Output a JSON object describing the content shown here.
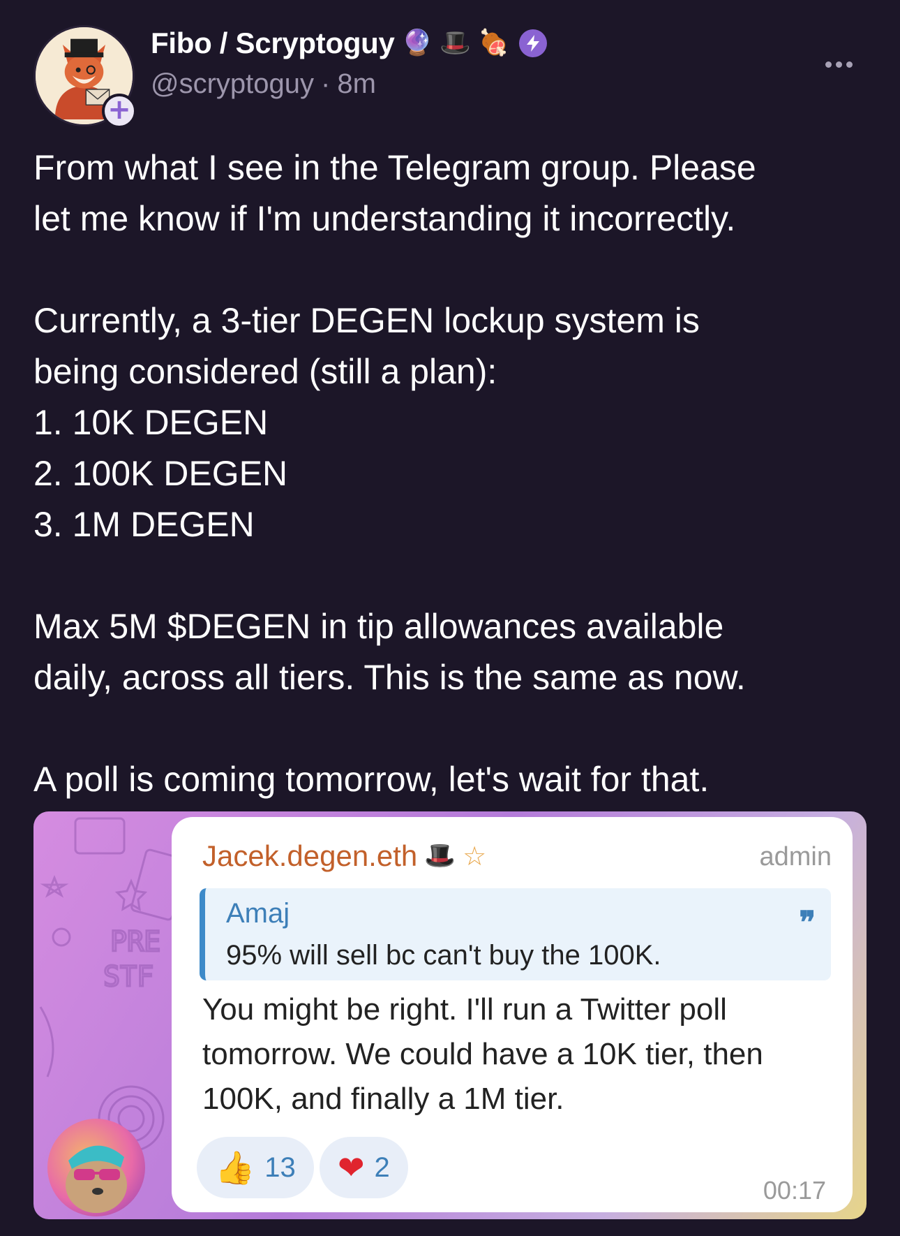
{
  "author": {
    "display_name": "Fibo / Scryptoguy",
    "handle": "@scryptoguy",
    "separator": "·",
    "time_ago": "8m",
    "name_emojis": [
      "🔮",
      "🎩",
      "🍖"
    ],
    "follow_symbol": "+"
  },
  "post": {
    "paragraphs": [
      "From what I see in the Telegram group. Please\nlet me know if I'm understanding it incorrectly.",
      "Currently, a 3-tier DEGEN lockup system is\nbeing considered (still a plan):\n1. 10K DEGEN\n2. 100K DEGEN\n3. 1M DEGEN",
      "Max 5M $DEGEN in tip allowances available\ndaily, across all tiers. This is the same as now.",
      "A poll is coming tomorrow, let's wait for that."
    ]
  },
  "telegram_message": {
    "sender": "Jacek.degen.eth",
    "sender_emojis": [
      "🎩",
      "☆"
    ],
    "role": "admin",
    "reply": {
      "author": "Amaj",
      "text": "95% will sell bc can't buy the 100K.",
      "quote_mark": "❞"
    },
    "text": "You might be right. I'll run a Twitter poll\ntomorrow. We could have a 10K tier, then\n100K, and finally a 1M tier.",
    "reactions": [
      {
        "emoji": "👍",
        "count": "13"
      },
      {
        "emoji": "❤",
        "count": "2"
      }
    ],
    "time": "00:17"
  },
  "colors": {
    "background": "#1c1628",
    "accent_purple": "#8a63d2",
    "muted_text": "#9d96ac",
    "sender_name": "#c2602a",
    "reply_accent": "#3d8ac9"
  }
}
